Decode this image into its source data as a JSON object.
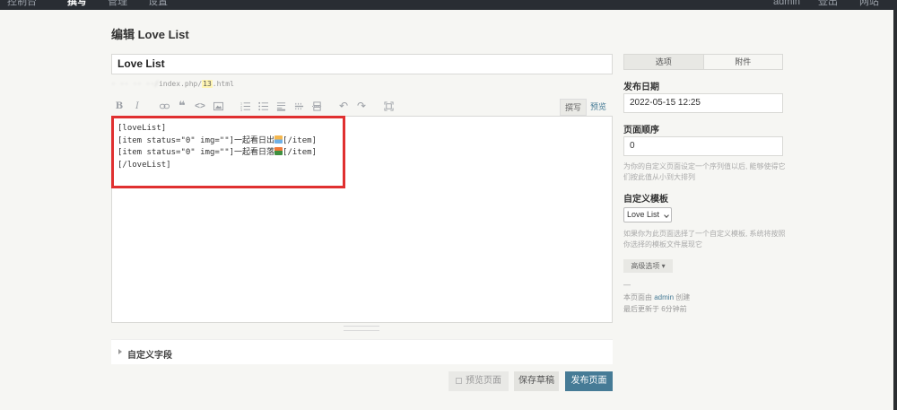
{
  "nav": {
    "items": [
      "控制台",
      "撰写",
      "管理",
      "设置"
    ],
    "right": [
      "admin",
      "登出",
      "网站"
    ]
  },
  "page_title": "编辑 Love List",
  "title_value": "Love List",
  "permalink": {
    "prefix": "·  ·· ·· ··/",
    "path": "index.php/",
    "slug": "13",
    "suffix": ".html"
  },
  "toolbar": {
    "write": "撰写",
    "preview": "预览"
  },
  "editor": {
    "lines": [
      "[loveList]",
      "[item status=\"0\" img=\"\"]一起看日出",
      "[/item]",
      "[item status=\"0\" img=\"\"]一起看日落",
      "[/item]",
      "[/loveList]"
    ]
  },
  "custom_fields_label": "自定义字段",
  "buttons": {
    "preview": "预览页面",
    "draft": "保存草稿",
    "publish": "发布页面"
  },
  "sidebar": {
    "tabs": [
      "选项",
      "附件"
    ],
    "publish_date_label": "发布日期",
    "publish_date_value": "2022-05-15 12:25",
    "order_label": "页面顺序",
    "order_value": "0",
    "order_desc": "为你的自定义页面设定一个序列值以后, 能够使得它们按此值从小到大排列",
    "template_label": "自定义模板",
    "template_value": "Love List",
    "template_desc": "如果你为此页面选择了一个自定义模板, 系统将按照你选择的模板文件展现它",
    "advanced": "高级选项",
    "dash": "—",
    "created_prefix": "本页面由",
    "created_user": "admin",
    "created_suffix": "创建",
    "updated": "最后更新于 6分钟前"
  }
}
